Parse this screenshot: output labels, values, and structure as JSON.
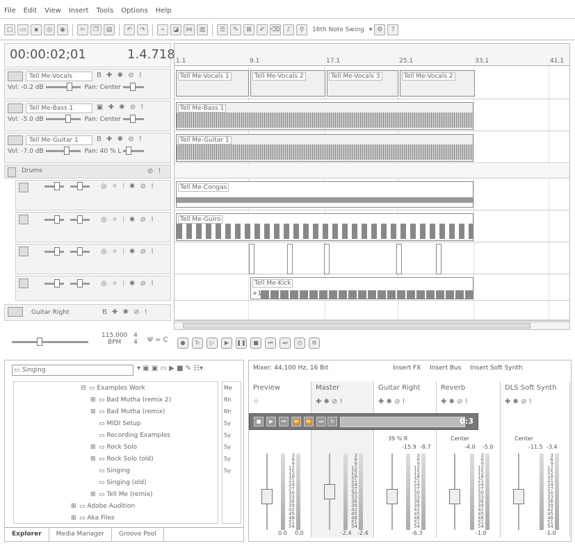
{
  "menu": [
    "File",
    "Edit",
    "View",
    "Insert",
    "Tools",
    "Options",
    "Help"
  ],
  "toolbar": {
    "swing_label": "16th Note Swing"
  },
  "timecode": "00:00:02;01",
  "beat_position": "1.4.718",
  "ruler": [
    "1.1",
    "9.1",
    "17.1",
    "25.1",
    "33.1",
    "41.1"
  ],
  "tracks": [
    {
      "name": "Tell Me-Vocals",
      "vol": "Vol: -0.2 dB",
      "pan": "Pan: Center"
    },
    {
      "name": "Tell Me-Bass 1",
      "vol": "Vol: -5.0 dB",
      "pan": "Pan: Center"
    },
    {
      "name": "Tell Me-Guitar 1",
      "vol": "Vol: -7.0 dB",
      "pan": "Pan: 40 % L"
    },
    {
      "name": "Drums"
    },
    {
      "name": "Guitar Right"
    }
  ],
  "clips": {
    "vocals": [
      "Tell Me-Vocals 1",
      "Tell Me-Vocals 2",
      "Tell Me-Vocals 3",
      "Tell Me-Vocals 2"
    ],
    "bass": "Tell Me-Bass 1",
    "guitar": "Tell Me-Guitar 1",
    "congas": "Tell Me-Congas",
    "guiro": "Tell Me-Guiro",
    "kick": "Tell Me-Kick",
    "kick_offset": "+1"
  },
  "tempo": {
    "bpm": "115.000",
    "bpm_label": "BPM",
    "sig_top": "4",
    "sig_bottom": "4",
    "key": "= C"
  },
  "explorer": {
    "folder": "Singing",
    "items": [
      {
        "label": "Examples Work",
        "level": 0,
        "exp": "⊟"
      },
      {
        "label": "Bad Mutha (remix 2)",
        "level": 1,
        "exp": "⊞"
      },
      {
        "label": "Bad Mutha (remix)",
        "level": 1,
        "exp": "⊞"
      },
      {
        "label": "MIDI Setup",
        "level": 1,
        "exp": ""
      },
      {
        "label": "Recording Examples",
        "level": 1,
        "exp": ""
      },
      {
        "label": "Rock Solo",
        "level": 1,
        "exp": "⊞"
      },
      {
        "label": "Rock Solo (old)",
        "level": 1,
        "exp": "⊞"
      },
      {
        "label": "Singing",
        "level": 1,
        "exp": ""
      },
      {
        "label": "Singing (old)",
        "level": 1,
        "exp": ""
      },
      {
        "label": "Tell Me (remix)",
        "level": 1,
        "exp": "⊞"
      },
      {
        "label": "Adobe Audition",
        "level": -1,
        "exp": "⊞"
      },
      {
        "label": "Aka Files",
        "level": -1,
        "exp": "⊞"
      }
    ],
    "side_files": [
      "Me",
      "Rh",
      "Rh",
      "Sy",
      "Sy",
      "Sy",
      "Sy",
      "Sy"
    ],
    "tabs": [
      "Explorer",
      "Media Manager",
      "Groove Pool"
    ]
  },
  "mixer": {
    "header": "Mixer: 44,100 Hz, 16 Bit",
    "insert_fx": "Insert FX",
    "insert_bus": "Insert Bus",
    "insert_synth": "Insert Soft Synth",
    "strips": [
      {
        "name": "Preview",
        "bottom_l": "0.0",
        "bottom_r": "0.0"
      },
      {
        "name": "Master",
        "bottom_l": "-2.4",
        "bottom_r": "-2.4"
      },
      {
        "name": "Guitar Right",
        "pan": "39 % R",
        "top_l": "-15.9",
        "top_r": "-8.7",
        "bottom": "-6.3"
      },
      {
        "name": "Reverb",
        "pan": "Center",
        "top_l": "-4.0",
        "top_r": "-5.0",
        "bottom": "-1.0"
      },
      {
        "name": "DLS Soft Synth",
        "pan": "Center",
        "top_l": "-11.5",
        "top_r": "-3.4",
        "bottom": "-1.0"
      }
    ],
    "scale": [
      "3",
      "6",
      "9",
      "12",
      "15",
      "18",
      "21",
      "24",
      "27",
      "30",
      "33",
      "36",
      "39",
      "42",
      "45",
      "48",
      "51",
      "54"
    ],
    "player_time": "0:3"
  }
}
